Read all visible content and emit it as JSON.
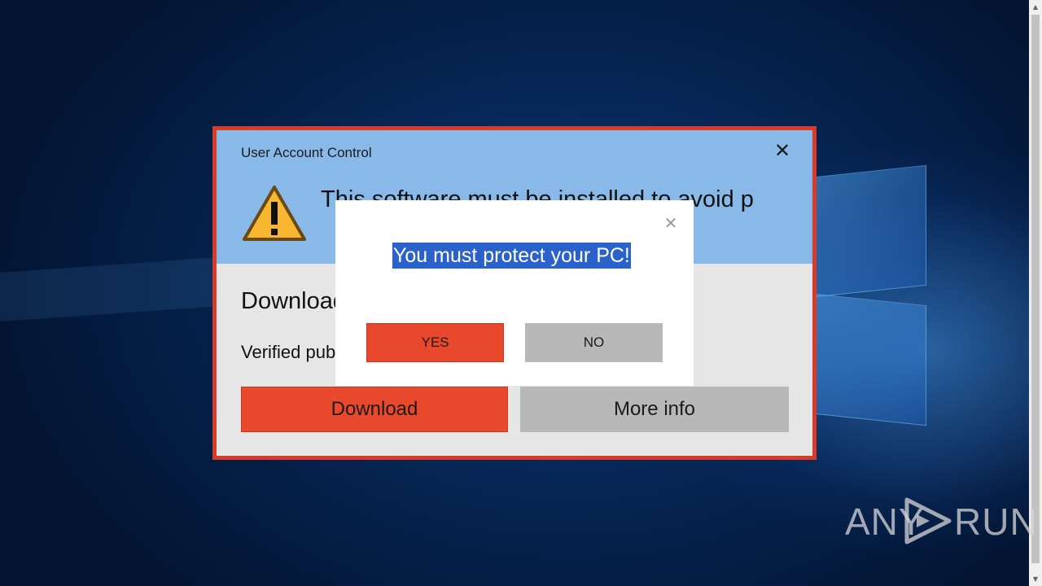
{
  "uac_dialog": {
    "title": "User Account Control",
    "close_glyph": "✕",
    "message": "This software must be installed to avoid p",
    "body_title": "Download",
    "publisher_label": "Verified pub",
    "download_label": "Download",
    "more_info_label": "More info",
    "icon": "warning-icon"
  },
  "popup": {
    "close_glyph": "✕",
    "title": "You must protect your PC!",
    "yes_label": "YES",
    "no_label": "NO"
  },
  "watermark": {
    "left_text": "ANY",
    "right_text": "RUN"
  },
  "scrollbar": {
    "up_glyph": "▲",
    "down_glyph": "▼"
  },
  "colors": {
    "dialog_border": "#d83b2a",
    "dialog_header": "#88b9e9",
    "accent_button": "#e8492c",
    "secondary_button": "#b8b8b8",
    "selection": "#2b62c9"
  }
}
